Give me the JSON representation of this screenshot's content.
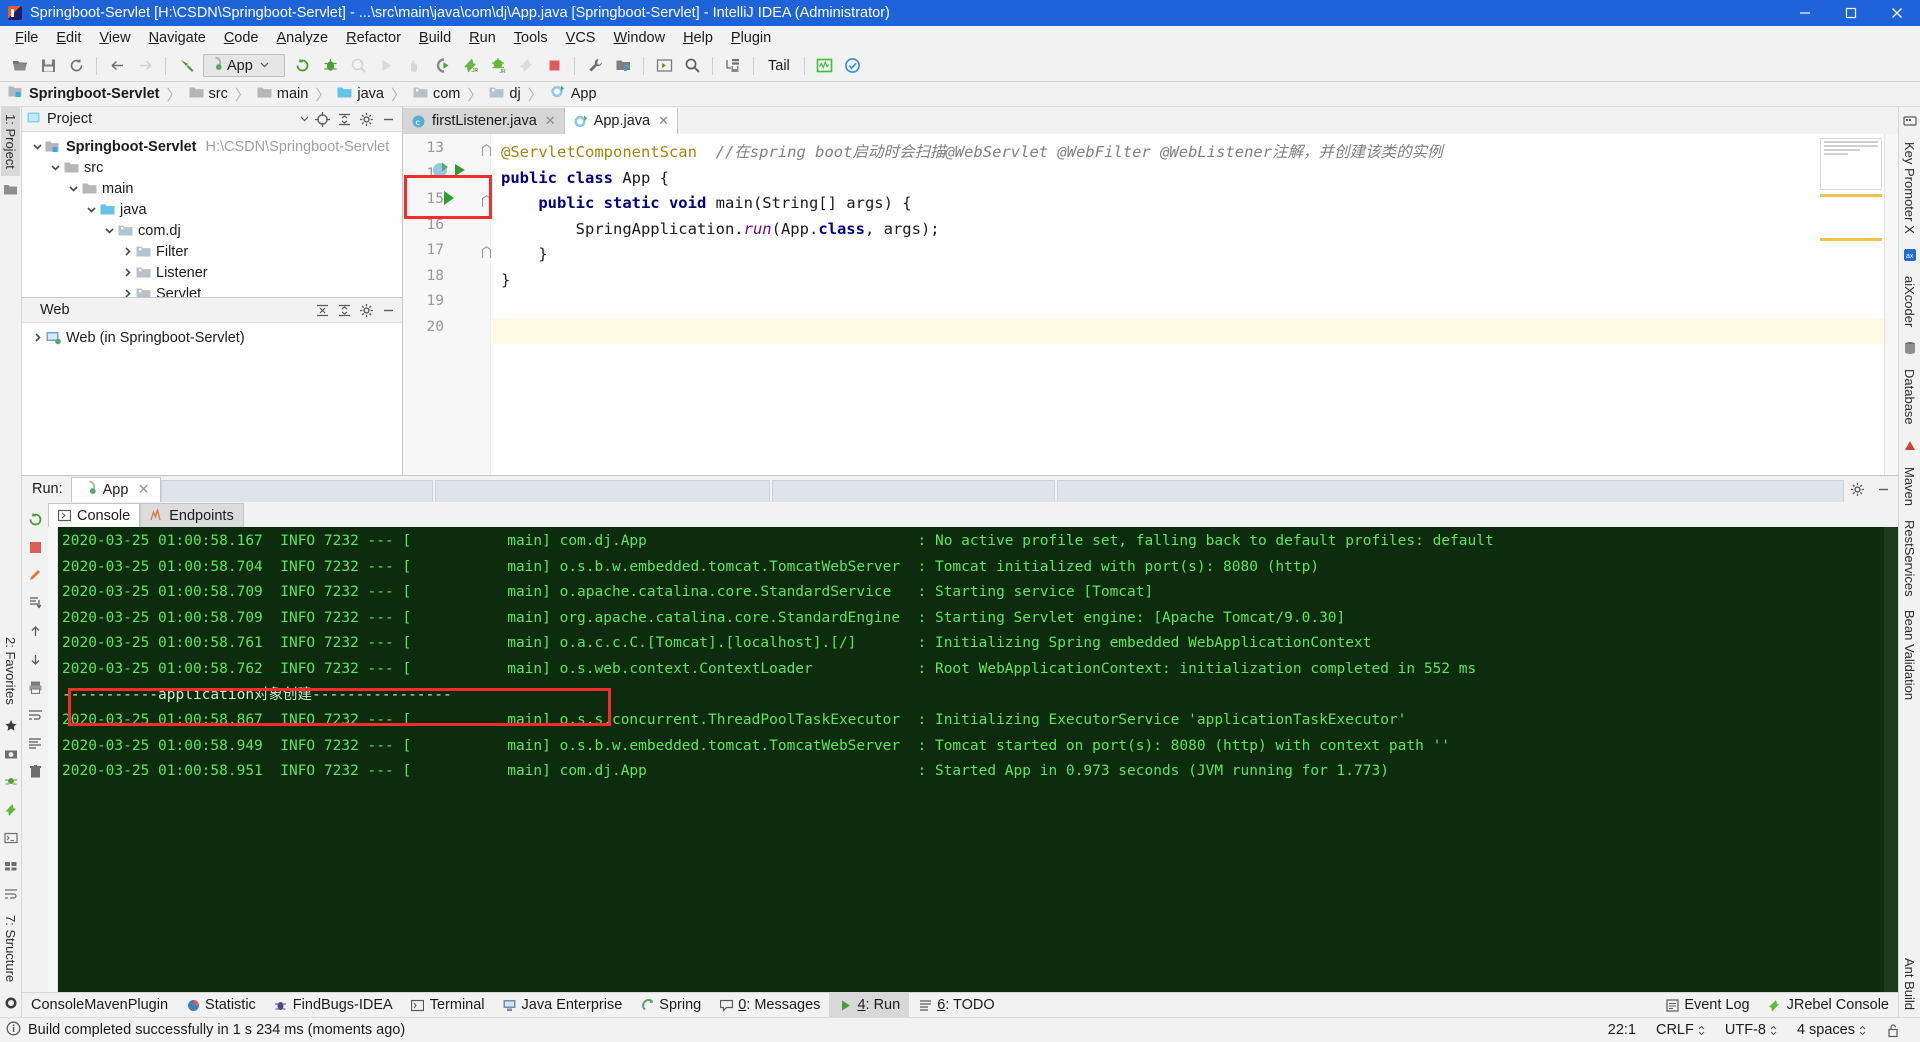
{
  "window": {
    "title": "Springboot-Servlet [H:\\CSDN\\Springboot-Servlet] - ...\\src\\main\\java\\com\\dj\\App.java [Springboot-Servlet] - IntelliJ IDEA (Administrator)",
    "minimize": "─",
    "maximize": "□",
    "close": "✕"
  },
  "menu": [
    {
      "label": "File"
    },
    {
      "label": "Edit"
    },
    {
      "label": "View"
    },
    {
      "label": "Navigate"
    },
    {
      "label": "Code"
    },
    {
      "label": "Analyze"
    },
    {
      "label": "Refactor"
    },
    {
      "label": "Build"
    },
    {
      "label": "Run"
    },
    {
      "label": "Tools"
    },
    {
      "label": "VCS"
    },
    {
      "label": "Window"
    },
    {
      "label": "Help"
    },
    {
      "label": "Plugin"
    }
  ],
  "toolbar": {
    "run_config": "App",
    "tail_label": "Tail",
    "icons": [
      "open-folder-icon",
      "save-all-icon",
      "sync-refresh-icon",
      "back-arrow-icon",
      "forward-arrow-icon",
      "build-hammer-icon"
    ],
    "right_icons": [
      "rerun-icon",
      "debug-bug-icon",
      "coverage-icon",
      "run-icon",
      "attach-icon",
      "profile-icon",
      "jrebel-run-icon",
      "jrebel-debug-icon",
      "jrebel-idle-icon",
      "stop-icon",
      "settings-wrench-icon",
      "project-structure-icon",
      "console-icon",
      "search-icon",
      "database-icon",
      "tail-icon",
      "monitor-icon",
      "check-circle-icon"
    ]
  },
  "breadcrumb": [
    {
      "label": "Springboot-Servlet",
      "icon": "module-icon",
      "bold": true
    },
    {
      "label": "src",
      "icon": "folder-icon",
      "bold": false
    },
    {
      "label": "main",
      "icon": "folder-icon",
      "bold": false
    },
    {
      "label": "java",
      "icon": "source-folder-icon",
      "bold": false
    },
    {
      "label": "com",
      "icon": "package-icon",
      "bold": false
    },
    {
      "label": "dj",
      "icon": "package-icon",
      "bold": false
    },
    {
      "label": "App",
      "icon": "spring-class-icon",
      "bold": false
    }
  ],
  "left_rail": {
    "tabs": [
      {
        "label": "1: Project",
        "active": true
      },
      {
        "label": "2: Favorites",
        "active": false
      },
      {
        "label": "7: Structure",
        "active": false
      }
    ],
    "icons": [
      "structure-icon",
      "jrebel-icon",
      "camera-icon",
      "ant-icon",
      "bookmark-icon",
      "terminal-icon",
      "web-icon"
    ]
  },
  "right_rail": {
    "tabs": [
      {
        "label": "Key Promoter X"
      },
      {
        "label": "aiXcoder"
      },
      {
        "label": "Database"
      },
      {
        "label": "Maven"
      },
      {
        "label": "RestServices"
      },
      {
        "label": "Bean Validation"
      },
      {
        "label": "Ant Build"
      }
    ]
  },
  "project_panel": {
    "title": "Project",
    "header_icons": [
      "locate-icon",
      "collapse-all-icon",
      "settings-gear-icon",
      "hide-icon"
    ],
    "tree": [
      {
        "label": "Springboot-Servlet",
        "path": "H:\\CSDN\\Springboot-Servlet",
        "depth": 0,
        "arrow": "down",
        "icon": "module-icon",
        "bold": true
      },
      {
        "label": "src",
        "path": "",
        "depth": 1,
        "arrow": "down",
        "icon": "folder-icon",
        "bold": false
      },
      {
        "label": "main",
        "path": "",
        "depth": 2,
        "arrow": "down",
        "icon": "folder-icon",
        "bold": false
      },
      {
        "label": "java",
        "path": "",
        "depth": 3,
        "arrow": "down",
        "icon": "source-folder-icon",
        "bold": false
      },
      {
        "label": "com.dj",
        "path": "",
        "depth": 4,
        "arrow": "down",
        "icon": "package-icon",
        "bold": false
      },
      {
        "label": "Filter",
        "path": "",
        "depth": 5,
        "arrow": "right",
        "icon": "package-icon",
        "bold": false
      },
      {
        "label": "Listener",
        "path": "",
        "depth": 5,
        "arrow": "right",
        "icon": "package-icon",
        "bold": false
      },
      {
        "label": "Servlet",
        "path": "",
        "depth": 5,
        "arrow": "right",
        "icon": "package-icon",
        "bold": false
      }
    ]
  },
  "web_panel": {
    "title": "Web",
    "header_icons": [
      "expand-all-icon",
      "collapse-all-icon",
      "settings-gear-icon",
      "hide-icon"
    ],
    "tree": [
      {
        "label": "Web (in Springboot-Servlet)",
        "depth": 0,
        "arrow": "right",
        "icon": "web-facet-icon"
      }
    ]
  },
  "editor": {
    "tabs": [
      {
        "label": "firstListener.java",
        "icon": "java-class-icon",
        "active": false
      },
      {
        "label": "App.java",
        "icon": "spring-class-icon",
        "active": true
      }
    ],
    "lines": [
      {
        "num": "13",
        "segments": [
          {
            "t": "@ServletComponentScan",
            "c": "ann"
          },
          {
            "t": "  ",
            "c": "plain"
          },
          {
            "t": "//在spring boot启动时会扫描@WebServlet @WebFilter @WebListener注解，并创建该类的实例",
            "c": "cmt"
          }
        ]
      },
      {
        "num": "14",
        "segments": [
          {
            "t": "public class",
            "c": "kw"
          },
          {
            "t": " App {",
            "c": "plain"
          }
        ]
      },
      {
        "num": "15",
        "segments": [
          {
            "t": "    ",
            "c": "plain"
          },
          {
            "t": "public static void",
            "c": "kw"
          },
          {
            "t": " main(String[] args) {",
            "c": "plain"
          }
        ]
      },
      {
        "num": "16",
        "segments": [
          {
            "t": "        SpringApplication.",
            "c": "plain"
          },
          {
            "t": "run",
            "c": "fld"
          },
          {
            "t": "(App.",
            "c": "plain"
          },
          {
            "t": "class",
            "c": "kw"
          },
          {
            "t": ", args);",
            "c": "plain"
          }
        ]
      },
      {
        "num": "17",
        "segments": [
          {
            "t": "    }",
            "c": "plain"
          }
        ]
      },
      {
        "num": "18",
        "segments": [
          {
            "t": "}",
            "c": "plain"
          }
        ]
      },
      {
        "num": "19",
        "segments": [
          {
            "t": "",
            "c": "plain"
          }
        ]
      },
      {
        "num": "20",
        "segments": [
          {
            "t": "",
            "c": "plain"
          }
        ]
      }
    ],
    "caret_line_index": 7
  },
  "run_window": {
    "label": "Run:",
    "tab": "App",
    "tab_icon": "spring-run-icon",
    "close": "✕",
    "header_icons": [
      "settings-gear-icon",
      "hide-icon"
    ],
    "sidebar_icons": [
      "rerun-icon",
      "stop-icon",
      "pen-icon",
      "scroll-down-icon",
      "up-arrow-icon",
      "down-arrow-icon",
      "print-icon",
      "soft-wrap-icon",
      "clear-all-icon",
      "trash-icon"
    ],
    "subtabs": [
      {
        "label": "Console",
        "icon": "console-icon",
        "active": true
      },
      {
        "label": "Endpoints",
        "icon": "endpoints-icon",
        "active": false
      }
    ],
    "console_lines": [
      "2020-03-25 01:00:58.167  INFO 7232 --- [           main] com.dj.App                               : No active profile set, falling back to default profiles: default",
      "2020-03-25 01:00:58.704  INFO 7232 --- [           main] o.s.b.w.embedded.tomcat.TomcatWebServer  : Tomcat initialized with port(s): 8080 (http)",
      "2020-03-25 01:00:58.709  INFO 7232 --- [           main] o.apache.catalina.core.StandardService   : Starting service [Tomcat]",
      "2020-03-25 01:00:58.709  INFO 7232 --- [           main] org.apache.catalina.core.StandardEngine  : Starting Servlet engine: [Apache Tomcat/9.0.30]",
      "2020-03-25 01:00:58.761  INFO 7232 --- [           main] o.a.c.c.C.[Tomcat].[localhost].[/]       : Initializing Spring embedded WebApplicationContext",
      "2020-03-25 01:00:58.762  INFO 7232 --- [           main] o.s.web.context.ContextLoader            : Root WebApplicationContext: initialization completed in 552 ms",
      "-----------application对象创建----------------",
      "2020-03-25 01:00:58.867  INFO 7232 --- [           main] o.s.s.concurrent.ThreadPoolTaskExecutor  : Initializing ExecutorService 'applicationTaskExecutor'",
      "2020-03-25 01:00:58.949  INFO 7232 --- [           main] o.s.b.w.embedded.tomcat.TomcatWebServer  : Tomcat started on port(s): 8080 (http) with context path ''",
      "2020-03-25 01:00:58.951  INFO 7232 --- [           main] com.dj.App                               : Started App in 0.973 seconds (JVM running for 1.773)"
    ],
    "highlight_line_index": 6
  },
  "bottom_bar": {
    "left_items": [
      {
        "label": "ConsoleMavenPlugin",
        "icon": ""
      },
      {
        "label": "Statistic",
        "icon": "statistic-icon"
      },
      {
        "label": "FindBugs-IDEA",
        "icon": "findbugs-icon"
      },
      {
        "label": "Terminal",
        "icon": "terminal-icon"
      },
      {
        "label": "Java Enterprise",
        "icon": "java-ee-icon"
      },
      {
        "label": "Spring",
        "icon": "spring-icon"
      },
      {
        "label": "0: Messages",
        "icon": "messages-icon",
        "underline": "0"
      },
      {
        "label": "4: Run",
        "icon": "run-icon",
        "underline": "4",
        "active": true
      },
      {
        "label": "6: TODO",
        "icon": "todo-icon",
        "underline": "6"
      }
    ],
    "right_items": [
      {
        "label": "Event Log",
        "icon": "event-log-icon"
      },
      {
        "label": "JRebel Console",
        "icon": "jrebel-icon"
      }
    ]
  },
  "status_bar": {
    "message": "Build completed successfully in 1 s 234 ms (moments ago)",
    "message_icon": "info-icon",
    "caret_position": "22:1",
    "line_separator": "CRLF",
    "encoding": "UTF-8",
    "indent": "4 spaces",
    "lock_icon": "unlocked-icon"
  },
  "colors": {
    "title_bg": "#1f63d8",
    "console_bg": "#0d2b0d",
    "console_fg": "#5ce65c",
    "annotation_red": "#f42c2c",
    "accent_green": "#5a9e39"
  }
}
